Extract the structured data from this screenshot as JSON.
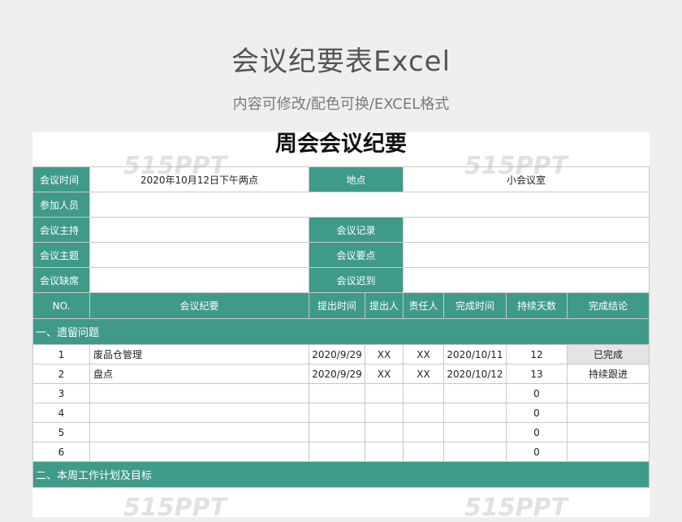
{
  "header": {
    "title": "会议纪要表Excel",
    "subtitle": "内容可修改/配色可换/EXCEL格式"
  },
  "doc_title": "周会会议纪要",
  "watermark": "515PPT",
  "meta": {
    "time_label": "会议时间",
    "time_value": "2020年10月12日下午两点",
    "place_label": "地点",
    "place_value": "小会议室",
    "participants_label": "参加人员",
    "host_label": "会议主持",
    "recorder_label": "会议记录",
    "topic_label": "会议主题",
    "key_points_label": "会议要点",
    "absent_label": "会议缺席",
    "late_label": "会议迟到"
  },
  "table": {
    "columns": [
      "NO.",
      "会议纪要",
      "提出时间",
      "提出人",
      "责任人",
      "完成时间",
      "持续天数",
      "完成结论"
    ],
    "section1": "一、遗留问题",
    "rows": [
      {
        "no": "1",
        "summary": "废品仓管理",
        "proposed": "2020/9/29",
        "proposer": "XX",
        "owner": "XX",
        "completed": "2020/10/11",
        "days": "12",
        "conclusion": "已完成"
      },
      {
        "no": "2",
        "summary": "盘点",
        "proposed": "2020/9/29",
        "proposer": "XX",
        "owner": "XX",
        "completed": "2020/10/12",
        "days": "13",
        "conclusion": "持续跟进"
      },
      {
        "no": "3",
        "summary": "",
        "proposed": "",
        "proposer": "",
        "owner": "",
        "completed": "",
        "days": "0",
        "conclusion": ""
      },
      {
        "no": "4",
        "summary": "",
        "proposed": "",
        "proposer": "",
        "owner": "",
        "completed": "",
        "days": "0",
        "conclusion": ""
      },
      {
        "no": "5",
        "summary": "",
        "proposed": "",
        "proposer": "",
        "owner": "",
        "completed": "",
        "days": "0",
        "conclusion": ""
      },
      {
        "no": "6",
        "summary": "",
        "proposed": "",
        "proposer": "",
        "owner": "",
        "completed": "",
        "days": "0",
        "conclusion": ""
      }
    ],
    "section2": "二、本周工作计划及目标"
  },
  "colors": {
    "accent": "#3f9a89",
    "background": "#efefef",
    "done_cell": "#e4e4e4"
  }
}
